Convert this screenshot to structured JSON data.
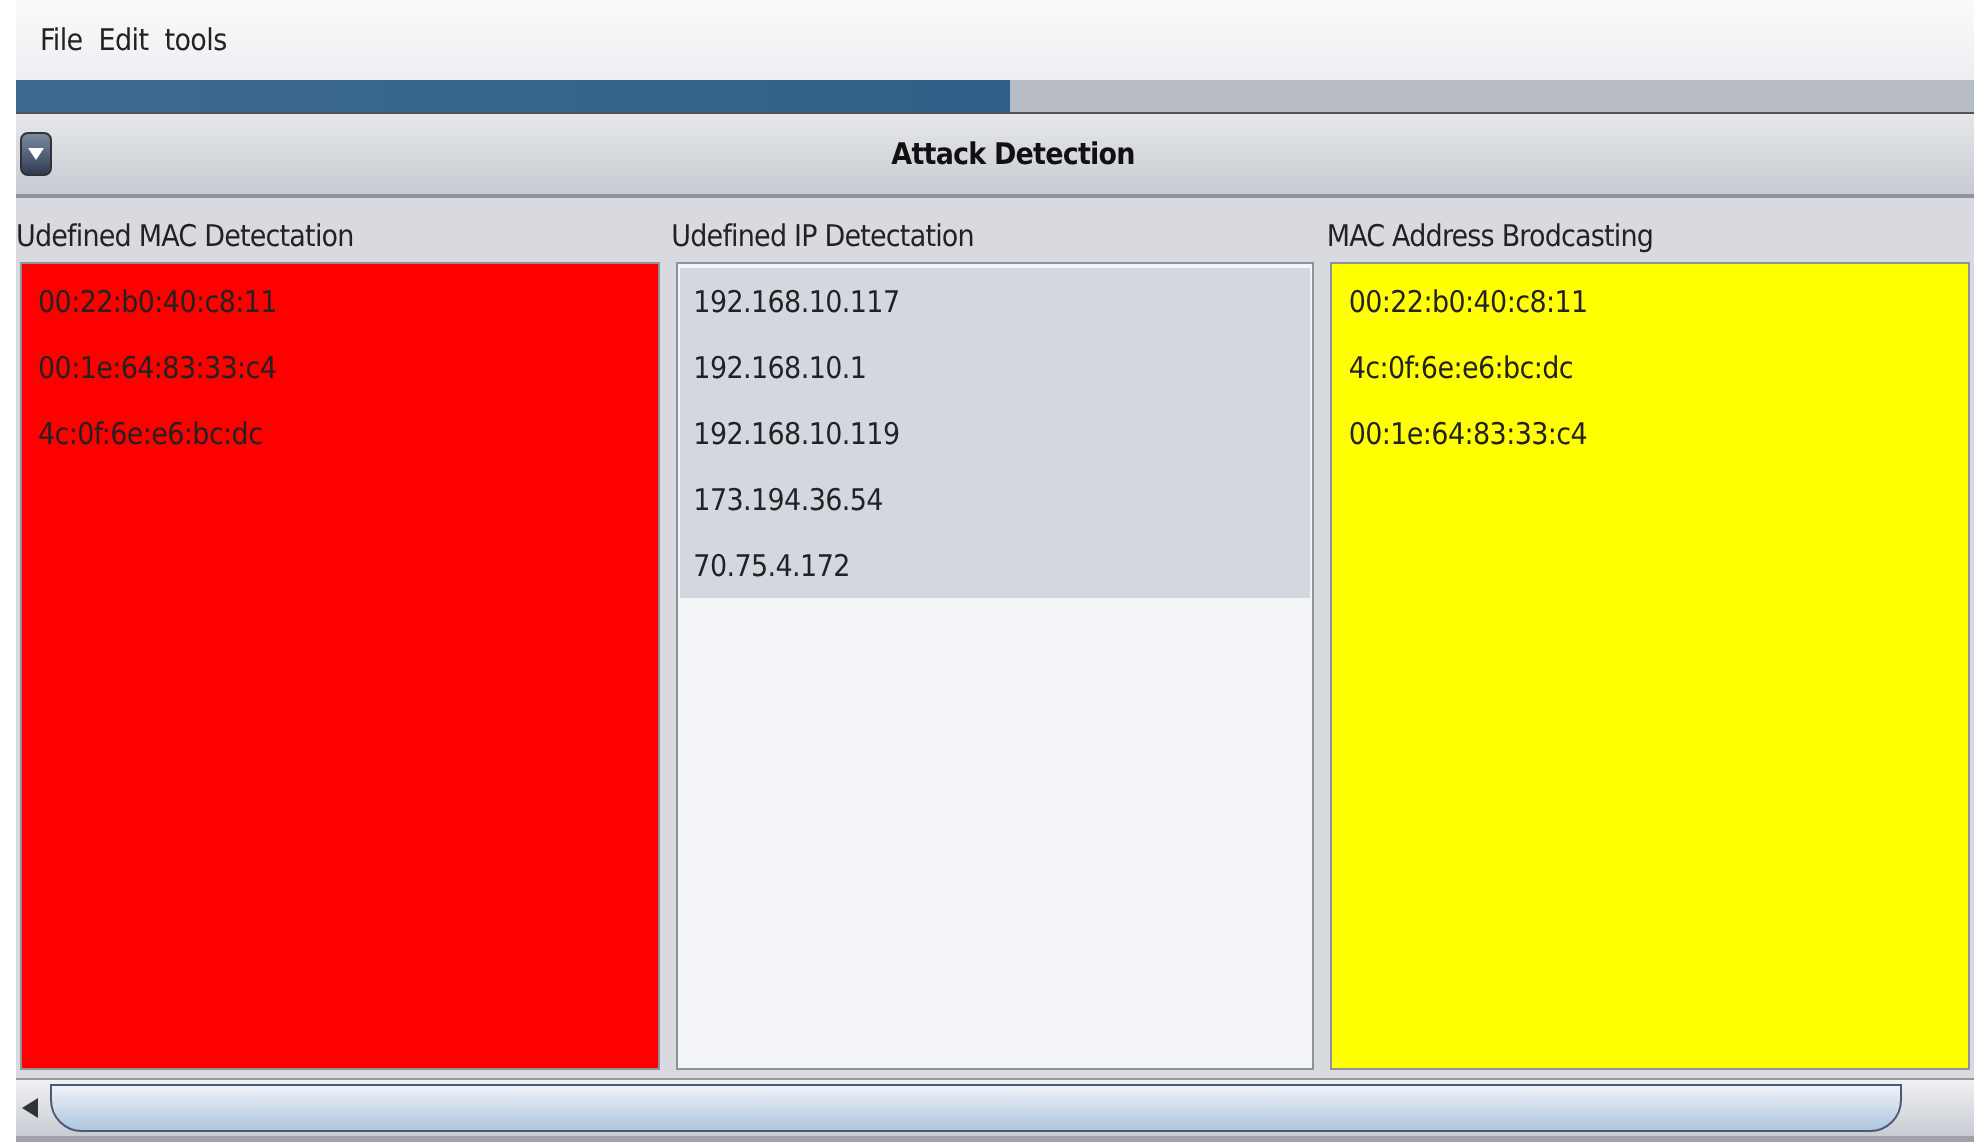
{
  "menu": [
    "File",
    "Edit",
    "tools"
  ],
  "panel": {
    "title": "Attack Detection"
  },
  "lists": [
    {
      "title": "Udefined MAC Detectation",
      "color": "#ff0000",
      "rows_shaded": false,
      "items": [
        "00:22:b0:40:c8:11",
        "00:1e:64:83:33:c4",
        "4c:0f:6e:e6:bc:dc"
      ]
    },
    {
      "title": "Udefined IP Detectation",
      "color": "#f4f5f8",
      "rows_shaded": true,
      "items": [
        "192.168.10.117",
        "192.168.10.1",
        "192.168.10.119",
        "173.194.36.54",
        "70.75.4.172"
      ]
    },
    {
      "title": "MAC Address Brodcasting",
      "color": "#ffff00",
      "rows_shaded": false,
      "items": [
        "00:22:b0:40:c8:11",
        "4c:0f:6e:e6:bc:dc",
        "00:1e:64:83:33:c4"
      ]
    }
  ]
}
